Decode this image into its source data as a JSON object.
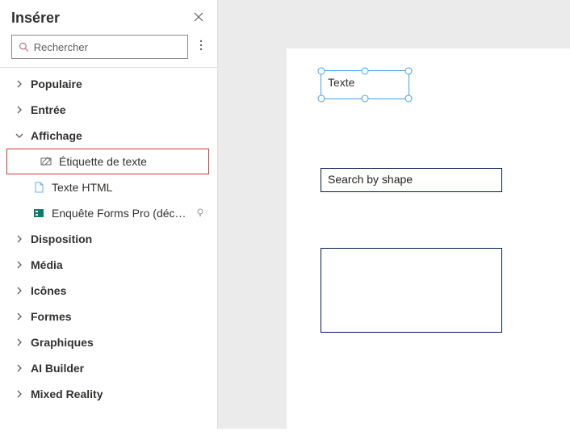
{
  "pane": {
    "title": "Insérer",
    "search_placeholder": "Rechercher"
  },
  "tree": {
    "populaire": "Populaire",
    "entree": "Entrée",
    "affichage": "Affichage",
    "etiquette_texte": "Étiquette de texte",
    "texte_html": "Texte HTML",
    "forms_pro": "Enquête Forms Pro (déconseillé)...",
    "disposition": "Disposition",
    "media": "Média",
    "icones": "Icônes",
    "formes": "Formes",
    "graphiques": "Graphiques",
    "ai_builder": "AI Builder",
    "mixed_reality": "Mixed Reality"
  },
  "canvas": {
    "label_text": "Texte",
    "input_placeholder": "Search by shape"
  },
  "icons": {
    "search": "search-icon",
    "close": "close-icon",
    "more": "more-icon",
    "chev_right": "chevron-right-icon",
    "chev_down": "chevron-down-icon",
    "edit_label": "edit-label-icon",
    "html": "html-file-icon",
    "forms": "forms-icon",
    "bulb": "lightbulb-icon"
  }
}
